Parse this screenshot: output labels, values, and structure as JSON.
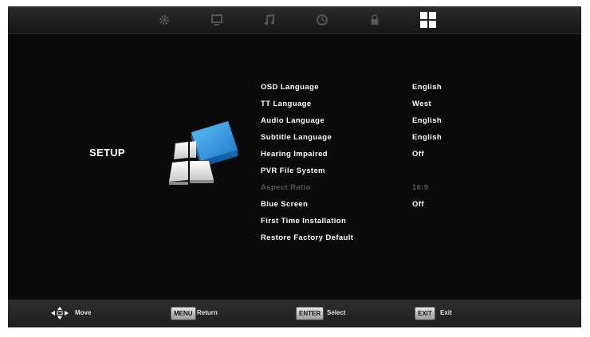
{
  "tabs": [
    {
      "name": "picture",
      "icon": "gear-icon"
    },
    {
      "name": "display",
      "icon": "monitor-icon"
    },
    {
      "name": "sound",
      "icon": "music-note-icon"
    },
    {
      "name": "time",
      "icon": "clock-icon"
    },
    {
      "name": "lock",
      "icon": "lock-icon"
    },
    {
      "name": "setup",
      "icon": "setup-grid-icon",
      "selected": true
    }
  ],
  "section": {
    "title": "SETUP"
  },
  "menu": {
    "items": [
      {
        "label": "OSD Language",
        "value": "English"
      },
      {
        "label": "TT Language",
        "value": "West"
      },
      {
        "label": "Audio Language",
        "value": "English"
      },
      {
        "label": "Subtitle Language",
        "value": "English"
      },
      {
        "label": "Hearing Impaired",
        "value": "Off"
      },
      {
        "label": "PVR File System",
        "value": ""
      },
      {
        "label": "Aspect Ratio",
        "value": "16:9",
        "disabled": true
      },
      {
        "label": "Blue Screen",
        "value": "Off"
      },
      {
        "label": "First Time Installation",
        "value": ""
      },
      {
        "label": "Restore Factory Default",
        "value": ""
      }
    ]
  },
  "footer": {
    "move": {
      "icon": "arrows-icon",
      "label": "Move"
    },
    "return": {
      "key": "MENU",
      "label": "Return"
    },
    "select": {
      "key": "ENTER",
      "label": "Select"
    },
    "exit": {
      "key": "EXIT",
      "label": "Exit"
    }
  },
  "colors": {
    "background": "#0a0a0a",
    "text": "#ffffff",
    "disabled": "#555555",
    "accent": "#2a8fd6"
  }
}
